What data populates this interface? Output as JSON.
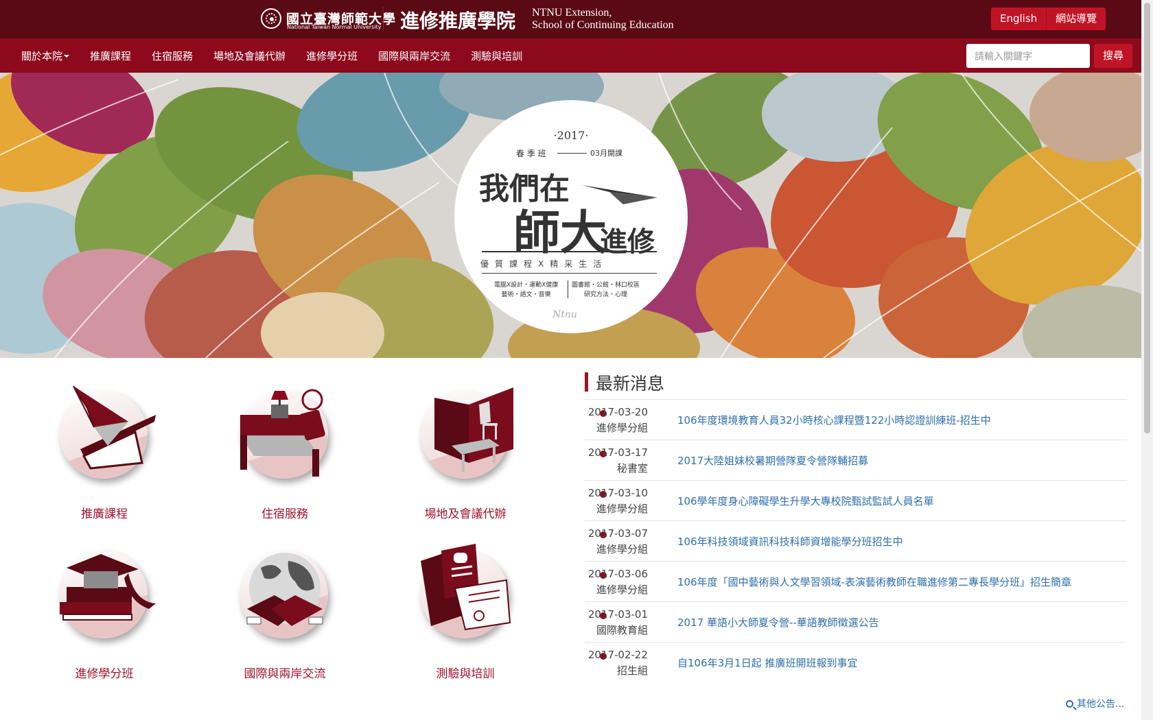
{
  "header": {
    "university_zh": "國立臺灣師範大學",
    "university_en": "National Taiwan Normal University",
    "site_title_zh": "進修推廣學院",
    "site_title_en_line1": "NTNU Extension,",
    "site_title_en_line2": "School of Continuing Education",
    "english_btn": "English",
    "sitemap_btn": "網站導覽"
  },
  "nav": {
    "items": [
      {
        "label": "關於本院",
        "dropdown": true
      },
      {
        "label": "推廣課程"
      },
      {
        "label": "住宿服務"
      },
      {
        "label": "場地及會議代辦"
      },
      {
        "label": "進修學分班"
      },
      {
        "label": "國際與兩岸交流"
      },
      {
        "label": "測驗與培訓"
      }
    ],
    "search_placeholder": "請輸入關鍵字",
    "search_btn": "搜尋"
  },
  "banner": {
    "year": "·2017·",
    "season": "春 季 班",
    "open": "03月開課",
    "headline_1": "我們在",
    "headline_2": "師大",
    "headline_3": "進修",
    "tagline": "優質課程X精采生活",
    "sub_left_1": "電腦X設計・運動X健康",
    "sub_left_2": "藝術・語文・音樂",
    "sub_right_1": "圖書館・公館・林口校區",
    "sub_right_2": "研究方法・心理",
    "signature": "Ntnu"
  },
  "services": [
    {
      "label": "推廣課程",
      "icon": "paper-plane-book-icon"
    },
    {
      "label": "住宿服務",
      "icon": "bed-lamp-icon"
    },
    {
      "label": "場地及會議代辦",
      "icon": "room-chair-icon"
    },
    {
      "label": "進修學分班",
      "icon": "graduation-cap-books-icon"
    },
    {
      "label": "國際與兩岸交流",
      "icon": "globe-handshake-icon"
    },
    {
      "label": "測驗與培訓",
      "icon": "test-paper-icon"
    }
  ],
  "news": {
    "title": "最新消息",
    "items": [
      {
        "date": "2017-03-20",
        "unit": "進修學分組",
        "title": "106年度環境教育人員32小時核心課程暨122小時認證訓練班-招生中"
      },
      {
        "date": "2017-03-17",
        "unit": "秘書室",
        "title": "2017大陸姐妹校暑期營隊夏令營隊輔招募"
      },
      {
        "date": "2017-03-10",
        "unit": "進修學分組",
        "title": "106學年度身心障礙學生升學大專校院甄試監試人員名單"
      },
      {
        "date": "2017-03-07",
        "unit": "進修學分組",
        "title": "106年科技領域資訊科技科師資增能學分班招生中"
      },
      {
        "date": "2017-03-06",
        "unit": "進修學分組",
        "title": "106年度「國中藝術與人文學習領域-表演藝術教師在職進修第二專長學分班」招生簡章"
      },
      {
        "date": "2017-03-01",
        "unit": "國際教育組",
        "title": "2017 華語小大師夏令營--華語教師徵選公告"
      },
      {
        "date": "2017-02-22",
        "unit": "招生組",
        "title": "自106年3月1日起 推廣班開班報到事宜"
      }
    ],
    "more": "其他公告..."
  },
  "colors": {
    "top_bar": "#5a0a14",
    "nav_bar": "#8c0a1c",
    "accent_button": "#c01426",
    "service_label": "#a0122a",
    "news_link": "#2f6fa8"
  }
}
